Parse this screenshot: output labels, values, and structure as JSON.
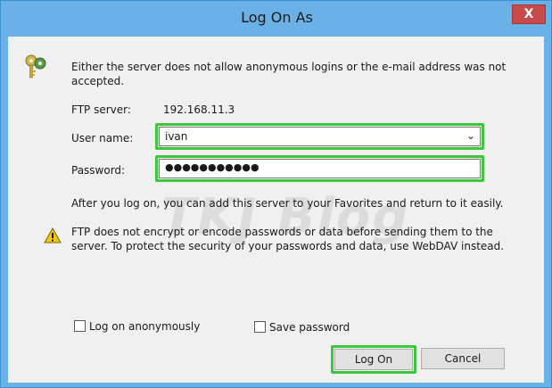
{
  "window": {
    "title": "Log On As",
    "close_label": "X"
  },
  "message": "Either the server does not allow anonymous logins or the e-mail address was not accepted.",
  "ftp_server": {
    "label": "FTP server:",
    "value": "192.168.11.3"
  },
  "username": {
    "label": "User name:",
    "value": "ivan"
  },
  "password": {
    "label": "Password:",
    "value": "●●●●●●●●●●●"
  },
  "favorites_note": "After you log on, you can add this server to your Favorites and return to it easily.",
  "warning": "FTP does not encrypt or encode passwords or data before sending them to the server.  To protect the security of your passwords and data, use WebDAV instead.",
  "watermark": "TKJ Blog",
  "checkboxes": {
    "anonymous": {
      "label": "Log on anonymously",
      "checked": false
    },
    "save_password": {
      "label": "Save password",
      "checked": false
    }
  },
  "buttons": {
    "logon": "Log On",
    "cancel": "Cancel"
  },
  "colors": {
    "highlight": "#3cc73c",
    "frame": "#69b1e6",
    "close": "#c74b4b"
  }
}
